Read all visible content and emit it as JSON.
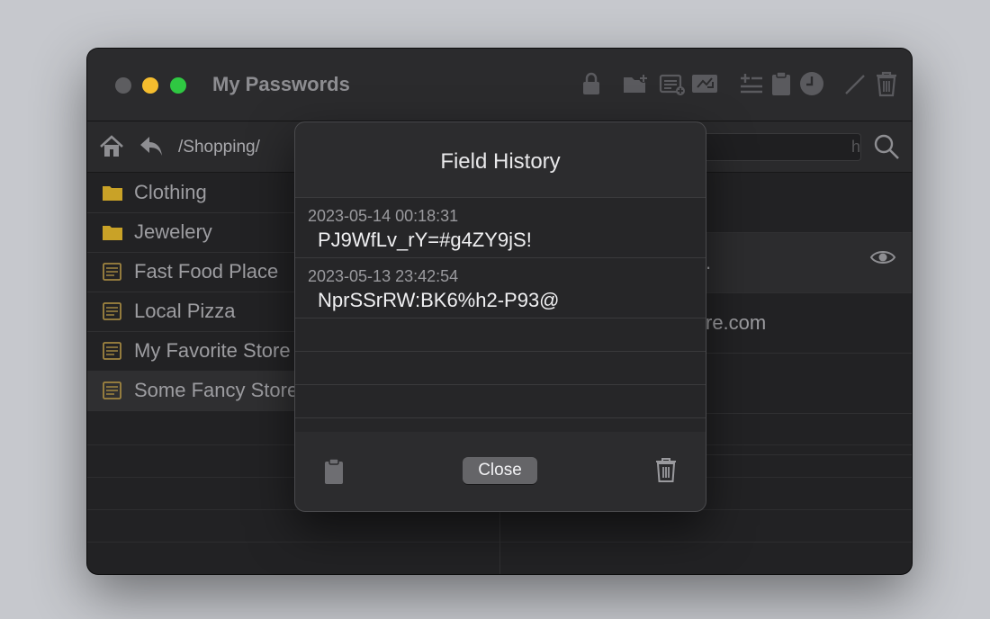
{
  "window": {
    "title": "My Passwords"
  },
  "toolbar": {
    "path": "/Shopping/",
    "search_placeholder": "h"
  },
  "sidebar": {
    "items": [
      {
        "label": "Clothing",
        "type": "folder"
      },
      {
        "label": "Jewelery",
        "type": "folder"
      },
      {
        "label": "Fast Food Place",
        "type": "entry"
      },
      {
        "label": "Local Pizza",
        "type": "entry"
      },
      {
        "label": "My Favorite Store",
        "type": "entry"
      },
      {
        "label": "Some Fancy Store",
        "type": "entry"
      }
    ]
  },
  "detail": {
    "masked": ".",
    "url_fragment": "re.com"
  },
  "dialog": {
    "title": "Field History",
    "history": [
      {
        "date": "2023-05-14 00:18:31",
        "value": "PJ9WfLv_rY=#g4ZY9jS!"
      },
      {
        "date": "2023-05-13 23:42:54",
        "value": "NprSSrRW:BK6%h2-P93@"
      }
    ],
    "close_label": "Close"
  },
  "colors": {
    "folder": "#c9a227",
    "close_light": "#5d5d60",
    "minimize_light": "#f5bd2e",
    "zoom_light": "#2fc842"
  }
}
